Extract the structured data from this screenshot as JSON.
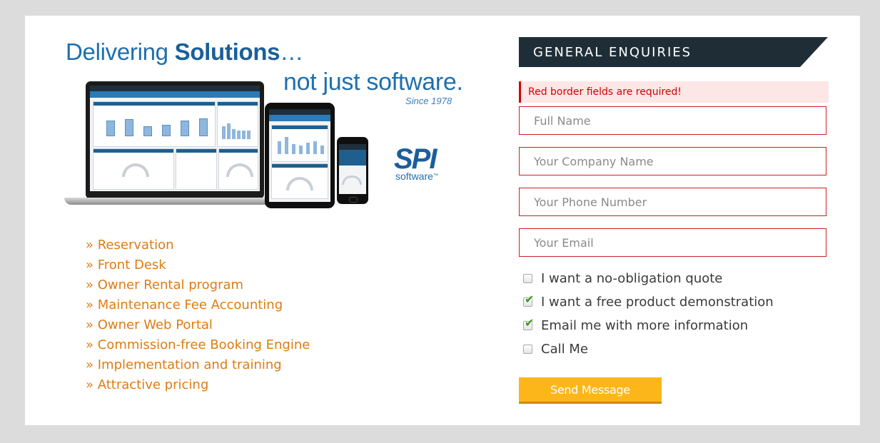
{
  "hero": {
    "line1_prefix": "Delivering ",
    "line1_bold": "Solutions",
    "line1_suffix": "…",
    "line2": "not just software.",
    "since": "Since 1978"
  },
  "logo": {
    "mark": "SPI",
    "word": "software",
    "trademark": "™"
  },
  "features": [
    "» Reservation",
    "» Front Desk",
    "» Owner Rental program",
    "» Maintenance Fee Accounting",
    "» Owner Web Portal",
    "» Commission-free Booking Engine",
    "» Implementation and training",
    "» Attractive pricing"
  ],
  "form": {
    "title": "GENERAL ENQUIRIES",
    "alert": "Red border fields are required!",
    "fields": {
      "full_name": "Full Name",
      "company": "Your Company Name",
      "phone": "Your Phone Number",
      "email": "Your Email"
    },
    "options": [
      {
        "label": "I want a no-obligation quote",
        "checked": false
      },
      {
        "label": "I want a free product demonstration",
        "checked": true
      },
      {
        "label": "Email me with more information",
        "checked": true
      },
      {
        "label": "Call Me",
        "checked": false
      }
    ],
    "submit": "Send Message"
  },
  "colors": {
    "page_bg": "#dcdcdc",
    "brand_blue": "#1e6fae",
    "feature_orange": "#e07b10",
    "header_dark": "#1f2e36",
    "required_red": "#cc1f1f",
    "button_yellow": "#fdb61a"
  }
}
